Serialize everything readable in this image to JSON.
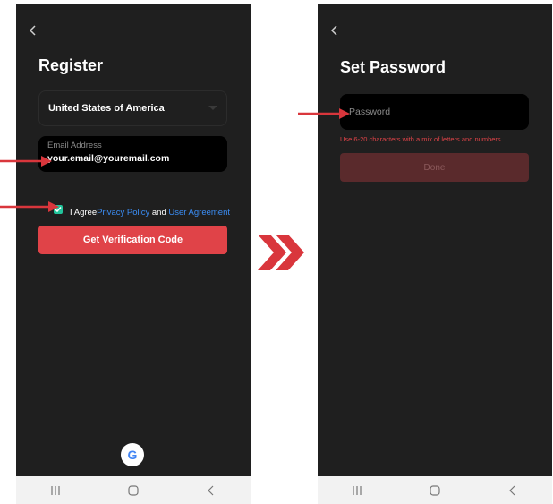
{
  "left_screen": {
    "title": "Register",
    "country": "United States of America",
    "email_label": "Email Address",
    "email_value": "your.email@youremail.com",
    "agree_prefix": "I Agree",
    "privacy_link": "Privacy Policy",
    "agree_and": " and ",
    "user_agreement_link": "User Agreement",
    "verify_button": "Get Verification Code",
    "google_letter": "G"
  },
  "right_screen": {
    "title": "Set Password",
    "password_placeholder": "Password",
    "hint": "Use 6-20 characters with a mix of letters and numbers",
    "done_button": "Done"
  },
  "icons": {
    "back": "chevron-left-icon",
    "dropdown": "triangle-down-icon",
    "checkbox": "check-icon",
    "nav_recents": "recents-icon",
    "nav_home": "home-icon",
    "nav_back": "back-icon",
    "next": "double-chevron-right-icon",
    "pointer": "arrow-right-icon"
  },
  "colors": {
    "accent_red": "#e04348",
    "checkbox_green": "#22c49b",
    "link_blue": "#3b8ef6",
    "phone_background": "#1f1f1f"
  }
}
